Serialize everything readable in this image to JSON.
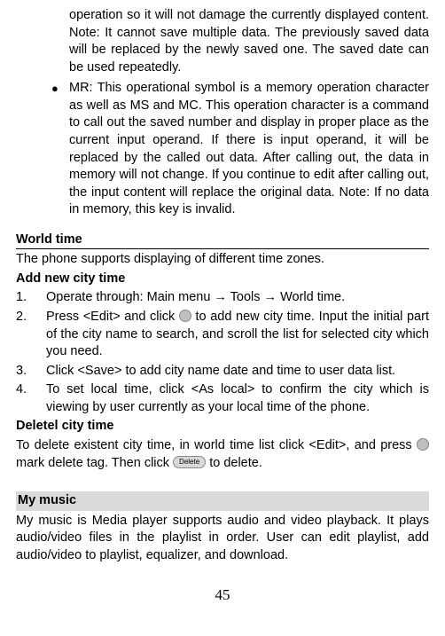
{
  "intro": {
    "cont_text": "operation so it will not damage the currently displayed content. Note: It cannot save multiple data. The previously saved data will be replaced by the newly saved one. The saved date can be used repeatedly.",
    "bullet_mr": "MR: This operational symbol is a memory operation character as well as MS and MC. This operation character is a command to call out the saved number and display in proper place as the current input operand. If there is input operand, it will be replaced by the called out data. After calling out, the data in memory will not change. If you continue to edit after calling out, the input content will replace the original data. Note: If no data in memory, this key is invalid."
  },
  "world_time": {
    "heading": "World time",
    "intro": "The phone supports displaying of different time zones.",
    "add_title": "Add new city time",
    "steps": {
      "s1": "Operate through: Main menu → Tools → World time.",
      "s2a": "Press <Edit> and click ",
      "s2b": " to add new city time. Input the initial part of the city name to search, and scroll the list for selected city which you need.",
      "s3": "Click <Save> to add city name date and time to user data list.",
      "s4": "To set local time, click <As local> to confirm the city which is viewing by user currently as your local time of the phone."
    },
    "del_title": "Deletel city time",
    "del_a": "To delete existent city time, in world time list click <Edit>, and press ",
    "del_b": " mark delete tag. Then click ",
    "del_c": " to delete.",
    "delete_btn_label": "Delete"
  },
  "my_music": {
    "heading": "My music",
    "text": "My music is Media player supports audio and video playback. It plays audio/video files in the playlist in order. User can edit playlist, add audio/video to playlist, equalizer, and download."
  },
  "nums": {
    "n1": "1.",
    "n2": "2.",
    "n3": "3.",
    "n4": "4."
  },
  "bullet_char": "●",
  "page_number": "45"
}
